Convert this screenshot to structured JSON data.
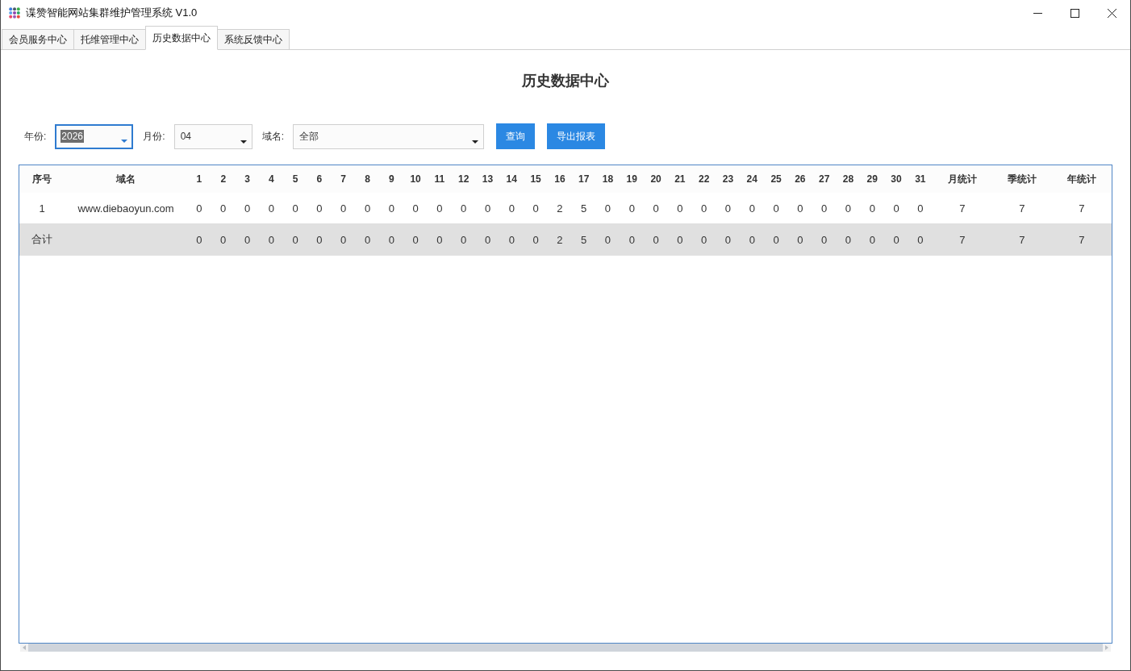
{
  "window": {
    "title": "谍赞智能网站集群维护管理系统 V1.0"
  },
  "tabs": [
    {
      "label": "会员服务中心",
      "selected": false
    },
    {
      "label": "托维管理中心",
      "selected": false
    },
    {
      "label": "历史数据中心",
      "selected": true
    },
    {
      "label": "系统反馈中心",
      "selected": false
    }
  ],
  "page_title": "历史数据中心",
  "filters": [
    {
      "label": "年份:",
      "value": "2026",
      "focused": true
    },
    {
      "label": "月份:",
      "value": "04",
      "focused": false
    },
    {
      "label": "域名:",
      "value": "全部",
      "focused": false
    }
  ],
  "buttons": [
    {
      "label": "查询"
    },
    {
      "label": "导出报表"
    }
  ],
  "table": {
    "columns": [
      "序号",
      "域名",
      "1",
      "2",
      "3",
      "4",
      "5",
      "6",
      "7",
      "8",
      "9",
      "10",
      "11",
      "12",
      "13",
      "14",
      "15",
      "16",
      "17",
      "18",
      "19",
      "20",
      "21",
      "22",
      "23",
      "24",
      "25",
      "26",
      "27",
      "28",
      "29",
      "30",
      "31",
      "月统计",
      "季统计",
      "年统计"
    ],
    "rows": [
      {
        "kind": "data",
        "index": "1",
        "domain": "www.diebaoyun.com",
        "values": [
          "0",
          "0",
          "0",
          "0",
          "0",
          "0",
          "0",
          "0",
          "0",
          "0",
          "0",
          "0",
          "0",
          "0",
          "0",
          "2",
          "5",
          "0",
          "0",
          "0",
          "0",
          "0",
          "0",
          "0",
          "0",
          "0",
          "0",
          "0",
          "0",
          "0",
          "0",
          "7",
          "7",
          "7"
        ]
      },
      {
        "kind": "total",
        "label": "合计",
        "values": [
          "0",
          "0",
          "0",
          "0",
          "0",
          "0",
          "0",
          "0",
          "0",
          "0",
          "0",
          "0",
          "0",
          "0",
          "0",
          "2",
          "5",
          "0",
          "0",
          "0",
          "0",
          "0",
          "0",
          "0",
          "0",
          "0",
          "0",
          "0",
          "0",
          "0",
          "0",
          "7",
          "7",
          "7"
        ]
      }
    ]
  }
}
